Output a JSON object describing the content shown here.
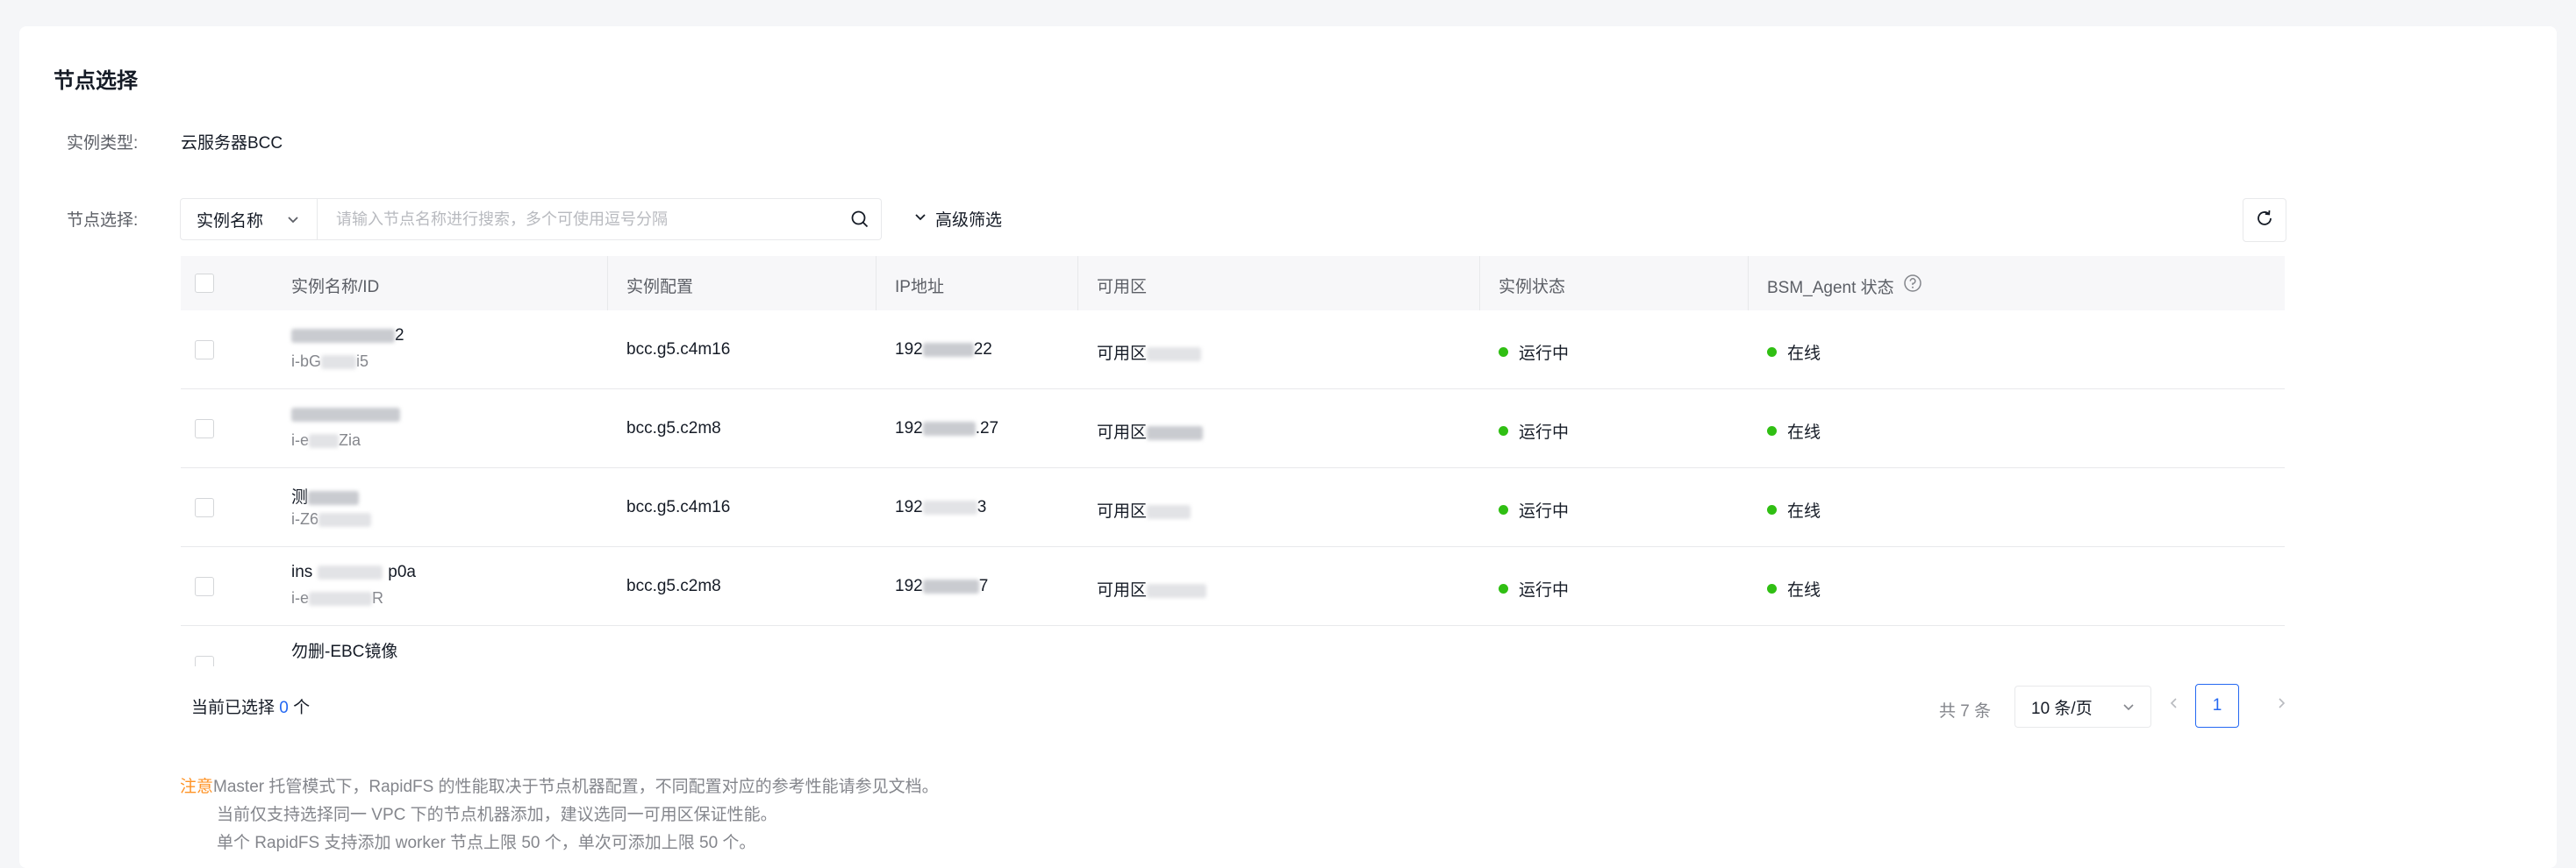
{
  "section_title": "节点选择",
  "instance_type": {
    "label": "实例类型:",
    "value": "云服务器BCC"
  },
  "node_select": {
    "label": "节点选择:",
    "filter_field": "实例名称",
    "search_placeholder": "请输入节点名称进行搜索，多个可使用逗号分隔",
    "advanced_filter": "高级筛选"
  },
  "table": {
    "headers": {
      "name_id": "实例名称/ID",
      "config": "实例配置",
      "ip": "IP地址",
      "zone": "可用区",
      "status": "实例状态",
      "agent": "BSM_Agent 状态"
    },
    "rows": [
      {
        "name": "2",
        "id": "i-bG",
        "id_tail": "i5",
        "config": "bcc.g5.c4m16",
        "ip": "192",
        "ip_tail": "22",
        "zone": "可用区",
        "status": "运行中",
        "agent": "在线"
      },
      {
        "name": "",
        "id": "i-e",
        "id_tail": "Zia",
        "config": "bcc.g5.c2m8",
        "ip": "192",
        "ip_tail": ".27",
        "zone": "可用区",
        "status": "运行中",
        "agent": "在线"
      },
      {
        "name": "测",
        "id": "i-Z6",
        "id_tail": "",
        "config": "bcc.g5.c4m16",
        "ip": "192",
        "ip_tail": "3",
        "zone": "可用区",
        "status": "运行中",
        "agent": "在线"
      },
      {
        "name": "ins",
        "name_tail": "p0a",
        "id": "i-e",
        "id_tail": "R",
        "config": "bcc.g5.c2m8",
        "ip": "192",
        "ip_tail": "7",
        "zone": "可用区",
        "status": "运行中",
        "agent": "在线"
      },
      {
        "name": "勿删-EBC镜像",
        "id": "",
        "id_tail": "",
        "config": "",
        "ip": "",
        "ip_tail": "",
        "zone": "",
        "status": "",
        "agent": ""
      }
    ]
  },
  "footer": {
    "selected_prefix": "当前已选择",
    "selected_count": "0",
    "selected_suffix": "个",
    "total": "共 7 条",
    "page_size": "10 条/页",
    "current_page": "1"
  },
  "notes": {
    "warn_label": "注意",
    "line1": "Master 托管模式下，RapidFS 的性能取决于节点机器配置，不同配置对应的参考性能请参见文档。",
    "line2": "当前仅支持选择同一 VPC 下的节点机器添加，建议选同一可用区保证性能。",
    "line3": "单个 RapidFS 支持添加 worker 节点上限 50 个，单次可添加上限 50 个。"
  },
  "colors": {
    "accent": "#2468f2",
    "running": "#30bf13",
    "warn": "#ff9326"
  }
}
